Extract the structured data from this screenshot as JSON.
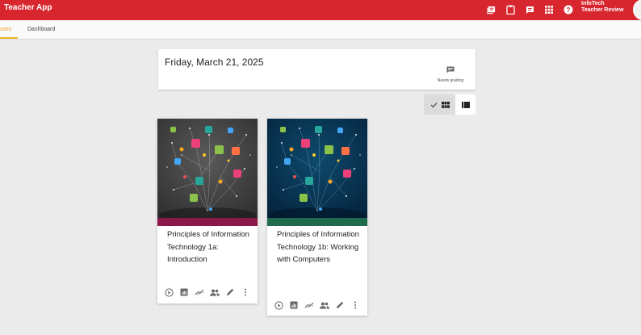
{
  "header": {
    "app_title": "Teacher App",
    "icons": [
      "library-icon",
      "clipboard-icon",
      "feedback-icon",
      "apps-grid-icon",
      "help-icon"
    ],
    "user_name_line1": "InfoTech",
    "user_name_line2": "Teacher Review",
    "bar_color": "#d8262e"
  },
  "tabs": {
    "active_label": "sses",
    "dashboard_label": "Dashboard",
    "accent_color": "#f0b92d"
  },
  "date_card": {
    "date": "Friday, March 21, 2025",
    "needs_grading_label": "Needs grading"
  },
  "view_toggle": {
    "selected": "grid-view",
    "options": [
      "grid-view",
      "list-view"
    ]
  },
  "courses": [
    {
      "title": "Principles of Information Technology 1a: Introduction",
      "image_theme": "gray",
      "stripe_color": "#8c1848",
      "actions": [
        "play-circle-icon",
        "report-icon",
        "trending-icon",
        "people-icon",
        "edit-icon",
        "more-vert-icon"
      ]
    },
    {
      "title": "Principles of Information Technology 1b: Working with Computers",
      "image_theme": "blue",
      "stripe_color": "#1e6a4a",
      "actions": [
        "play-circle-icon",
        "report-icon",
        "trending-icon",
        "people-icon",
        "edit-icon",
        "more-vert-icon"
      ]
    }
  ]
}
